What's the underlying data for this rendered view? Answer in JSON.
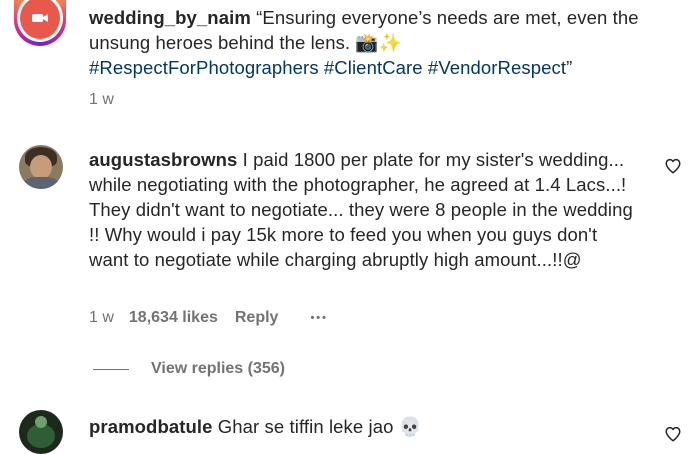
{
  "comments": [
    {
      "username": "wedding_by_naim",
      "text": "“Ensuring everyone’s needs are met, even the unsung heroes behind the lens. 📸✨",
      "hashtags": "#RespectForPhotographers #ClientCare #VendorRespect",
      "closing_quote": "”",
      "time": "1 w"
    },
    {
      "username": "augustasbrowns",
      "text": "I paid 1800 per plate for my sister's wedding... while negotiating with the photographer, he agreed at 1.4 Lacs...! They didn't want to negotiate... they were 8 people in the wedding !! Why would i pay 15k more to feed you when you guys don't want to negotiate while charging abruptly high amount...!!@",
      "time": "1 w",
      "likes": "18,634 likes",
      "reply_label": "Reply",
      "more": "•••",
      "view_replies": "View replies (356)"
    },
    {
      "username": "pramodbatule",
      "text": "Ghar se tiffin leke jao 💀"
    }
  ],
  "icons": {
    "heart": "heart-outline-icon",
    "more": "more-horizontal-icon",
    "video_camera": "video-camera-icon"
  },
  "colors": {
    "hashtag": "#00376b",
    "meta": "#737373",
    "text": "#262626",
    "story_ring_start": "#f9ce34",
    "story_ring_end": "#ee2a7b"
  }
}
